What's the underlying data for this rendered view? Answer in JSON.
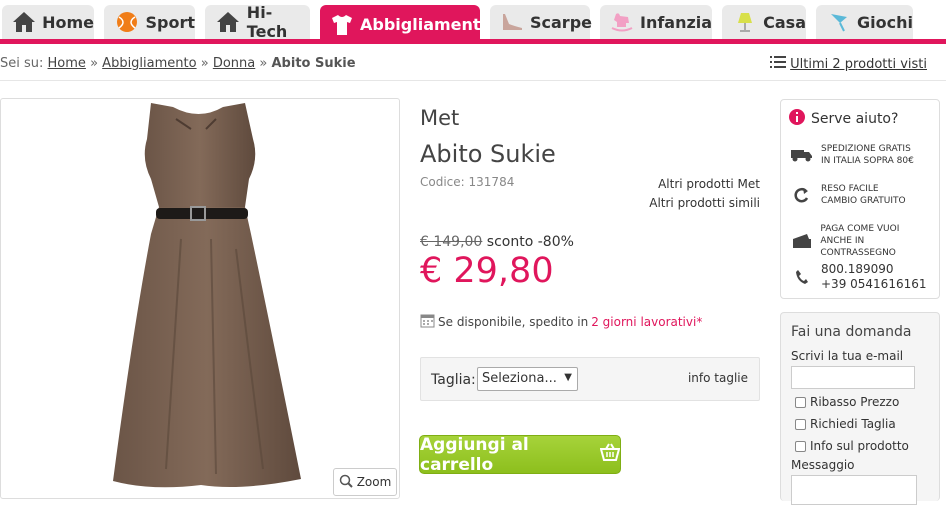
{
  "nav": {
    "tabs": [
      {
        "label": "Home",
        "icon": "home-icon"
      },
      {
        "label": "Sport",
        "icon": "ball-icon"
      },
      {
        "label": "Hi-Tech",
        "icon": "home-icon"
      },
      {
        "label": "Abbigliamento",
        "icon": "tshirt-icon",
        "active": true
      },
      {
        "label": "Scarpe",
        "icon": "shoe-icon"
      },
      {
        "label": "Infanzia",
        "icon": "rocking-horse-icon"
      },
      {
        "label": "Casa",
        "icon": "lamp-icon"
      },
      {
        "label": "Giochi",
        "icon": "kite-icon"
      }
    ],
    "accent": "#e0165c"
  },
  "breadcrumb": {
    "prefix": "Sei su:",
    "items": [
      "Home",
      "Abbigliamento",
      "Donna"
    ],
    "sep": "»",
    "current": "Abito Sukie"
  },
  "recent": {
    "label": "Ultimi 2 prodotti visti"
  },
  "product": {
    "brand": "Met",
    "name": "Abito Sukie",
    "code_label": "Codice:",
    "code": "131784",
    "link_brand": "Altri prodotti Met",
    "link_similar": "Altri prodotti simili",
    "old_price": "€ 149,00",
    "discount": "sconto -80%",
    "price": "€ 29,80",
    "ship_text": "Se disponibile, spedito in",
    "ship_days": "2 giorni lavorativi*",
    "size_label": "Taglia:",
    "size_select": "Seleziona...",
    "size_info": "info taglie",
    "add_button": "Aggiungi al carrello",
    "zoom": "Zoom"
  },
  "help": {
    "title": "Serve aiuto?",
    "items": [
      {
        "line1": "Spedizione gratis",
        "line2": "in Italia sopra 80€"
      },
      {
        "line1": "Reso facile",
        "line2": "cambio gratuito"
      },
      {
        "line1": "Paga come vuoi",
        "line2": "anche in contrassegno"
      }
    ],
    "phone1": "800.189090",
    "phone2": "+39 0541616161"
  },
  "ask": {
    "title": "Fai una domanda",
    "email_label": "Scrivi la tua e-mail",
    "options": [
      "Ribasso Prezzo",
      "Richiedi Taglia",
      "Info sul prodotto"
    ],
    "message_label": "Messaggio"
  }
}
